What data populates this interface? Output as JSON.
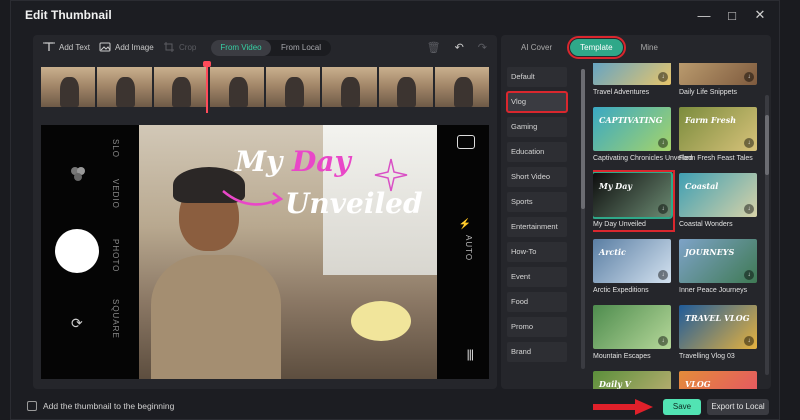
{
  "window": {
    "title": "Edit Thumbnail"
  },
  "toolbar": {
    "add_text": "Add Text",
    "add_image": "Add Image",
    "crop": "Crop",
    "tab_from_video": "From Video",
    "tab_from_local": "From Local"
  },
  "preview": {
    "overlay_line1_a": "My ",
    "overlay_line1_b": "Day",
    "overlay_line2": "Unveiled",
    "camera_labels": [
      "SLO",
      "VEDIO",
      "PHOTO",
      "SQUARE"
    ],
    "auto_label": "AUTO"
  },
  "right_tabs": [
    "AI Cover",
    "Template",
    "Mine"
  ],
  "categories": [
    "Default",
    "Vlog",
    "Gaming",
    "Education",
    "Short Video",
    "Sports",
    "Entertainment",
    "How-To",
    "Event",
    "Food",
    "Promo",
    "Brand"
  ],
  "templates": [
    {
      "name": "Travel Adventures",
      "thumb_text": "",
      "color1": "#4a9dd6",
      "color2": "#e7c56b"
    },
    {
      "name": "Daily Life Snippets",
      "thumb_text": "",
      "color1": "#c7a978",
      "color2": "#7e5a3e"
    },
    {
      "name": "Captivating Chronicles Unveiled",
      "thumb_text": "CAPTIVATING",
      "color1": "#39a8c4",
      "color2": "#a6d46a"
    },
    {
      "name": "Farm Fresh Feast Tales",
      "thumb_text": "Farm Fresh",
      "color1": "#7b8c3d",
      "color2": "#d7c27a"
    },
    {
      "name": "My Day Unveiled",
      "thumb_text": "My Day",
      "color1": "#0e0e0e",
      "color2": "#6b8a72"
    },
    {
      "name": "Coastal Wonders",
      "thumb_text": "Coastal",
      "color1": "#3f9fb3",
      "color2": "#d7d2a8"
    },
    {
      "name": "Arctic Expeditions",
      "thumb_text": "Arctic",
      "color1": "#5a7ea3",
      "color2": "#d4e2f0"
    },
    {
      "name": "Inner Peace Journeys",
      "thumb_text": "JOURNEYS",
      "color1": "#7ea3c8",
      "color2": "#3f7a54"
    },
    {
      "name": "Mountain Escapes",
      "thumb_text": "",
      "color1": "#4e8c4e",
      "color2": "#b6d89a"
    },
    {
      "name": "Travelling Vlog 03",
      "thumb_text": "TRAVEL VLOG",
      "color1": "#1f5b9a",
      "color2": "#e6b23f"
    },
    {
      "name": "",
      "thumb_text": "Daily V",
      "color1": "#5b8f3b",
      "color2": "#c8b37a"
    },
    {
      "name": "",
      "thumb_text": "VLOG",
      "color1": "#e48c3a",
      "color2": "#e64d6a"
    }
  ],
  "footer": {
    "checkbox_label": "Add the thumbnail to the beginning",
    "save": "Save",
    "export": "Export to Local"
  },
  "colors": {
    "accent": "#2fa889",
    "save": "#52e3b3",
    "highlight": "#d9272e"
  }
}
